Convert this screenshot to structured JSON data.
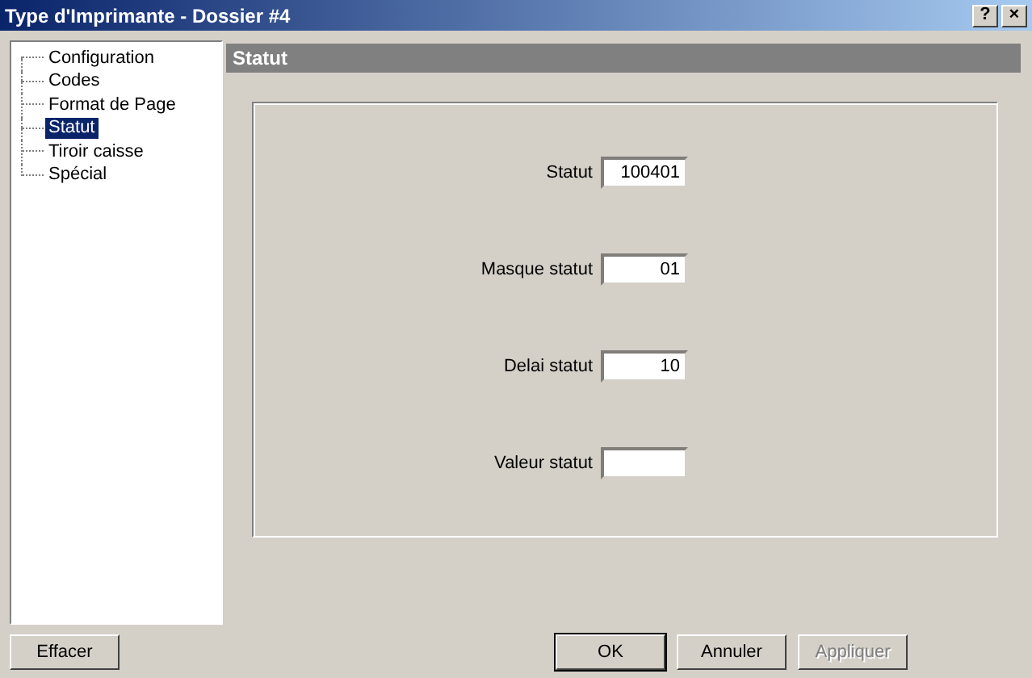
{
  "window": {
    "title": "Type d'Imprimante - Dossier #4",
    "help_button": "?",
    "close_button": "×"
  },
  "tree": {
    "items": [
      {
        "label": "Configuration",
        "selected": false
      },
      {
        "label": "Codes",
        "selected": false
      },
      {
        "label": "Format de Page",
        "selected": false
      },
      {
        "label": "Statut",
        "selected": true
      },
      {
        "label": "Tiroir caisse",
        "selected": false
      },
      {
        "label": "Spécial",
        "selected": false
      }
    ]
  },
  "page": {
    "title": "Statut",
    "fields": [
      {
        "label": "Statut",
        "value": "100401"
      },
      {
        "label": "Masque statut",
        "value": "01"
      },
      {
        "label": "Delai statut",
        "value": "10"
      },
      {
        "label": "Valeur statut"
      }
    ]
  },
  "buttons": [
    {
      "label": "Effacer",
      "disabled": false,
      "default": false
    },
    {
      "label": "OK",
      "disabled": false,
      "default": true
    },
    {
      "label": "Annuler",
      "disabled": false,
      "default": false
    },
    {
      "label": "Appliquer",
      "disabled": true,
      "default": false
    }
  ]
}
